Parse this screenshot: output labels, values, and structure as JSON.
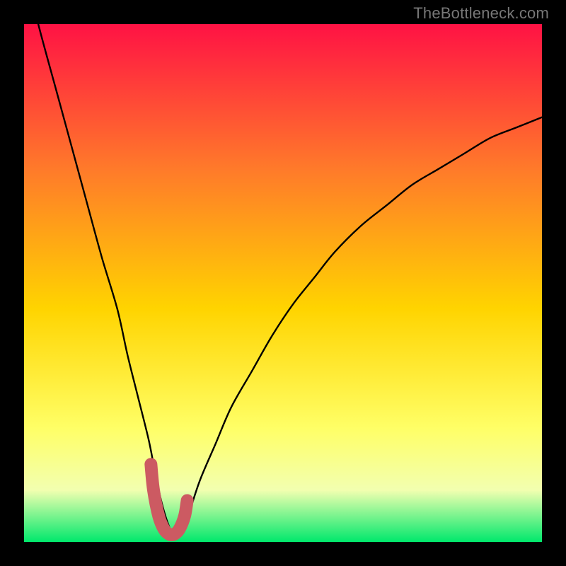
{
  "watermark": "TheBottleneck.com",
  "colors": {
    "frame_bg": "#000000",
    "grad_top": "#ff1244",
    "grad_mid1": "#ff7a2a",
    "grad_mid2": "#ffd400",
    "grad_mid3": "#ffff66",
    "grad_mid4": "#f2ffb0",
    "grad_bot": "#00e86c",
    "curve": "#000000",
    "marker": "#cc5a62"
  },
  "chart_data": {
    "type": "line",
    "title": "",
    "xlabel": "",
    "ylabel": "",
    "xlim": [
      0,
      100
    ],
    "ylim": [
      0,
      100
    ],
    "series": [
      {
        "name": "bottleneck-curve",
        "x": [
          0,
          3,
          6,
          9,
          12,
          15,
          18,
          20,
          22,
          24,
          25,
          26,
          27,
          28,
          29,
          30,
          31,
          32,
          34,
          37,
          40,
          44,
          48,
          52,
          56,
          60,
          65,
          70,
          75,
          80,
          85,
          90,
          95,
          100
        ],
        "y": [
          111,
          99,
          88,
          77,
          66,
          55,
          45,
          36,
          28,
          20,
          15,
          10,
          6,
          3,
          1,
          1,
          3,
          6,
          12,
          19,
          26,
          33,
          40,
          46,
          51,
          56,
          61,
          65,
          69,
          72,
          75,
          78,
          80,
          82
        ]
      }
    ],
    "marker_region": {
      "name": "sweet-spot",
      "x": [
        24.5,
        25,
        26,
        27,
        28,
        29,
        30,
        31,
        31.5
      ],
      "y": [
        15,
        10,
        5,
        2.5,
        1.5,
        1.5,
        2.5,
        5,
        8
      ]
    }
  }
}
